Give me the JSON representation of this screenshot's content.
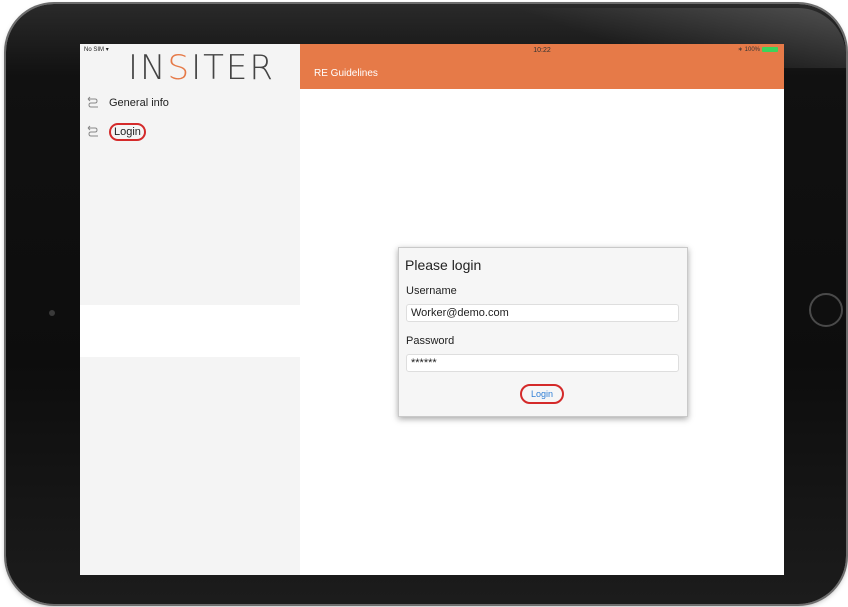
{
  "status_bar": {
    "carrier": "No SIM",
    "time": "10:22",
    "battery": "100%"
  },
  "logo": {
    "prefix": "IN",
    "accent": "S",
    "suffix": "ITER"
  },
  "sidebar": {
    "items": [
      {
        "label": "General info",
        "icon": "route-icon"
      },
      {
        "label": "Login",
        "icon": "route-icon"
      }
    ]
  },
  "header": {
    "title": "RE Guidelines"
  },
  "dialog": {
    "title": "Please login",
    "username_label": "Username",
    "username_value": "Worker@demo.com",
    "password_label": "Password",
    "password_value": "******",
    "login_label": "Login"
  },
  "colors": {
    "accent": "#e67a48",
    "highlight": "#d42a2a",
    "link": "#2f7fd6"
  }
}
